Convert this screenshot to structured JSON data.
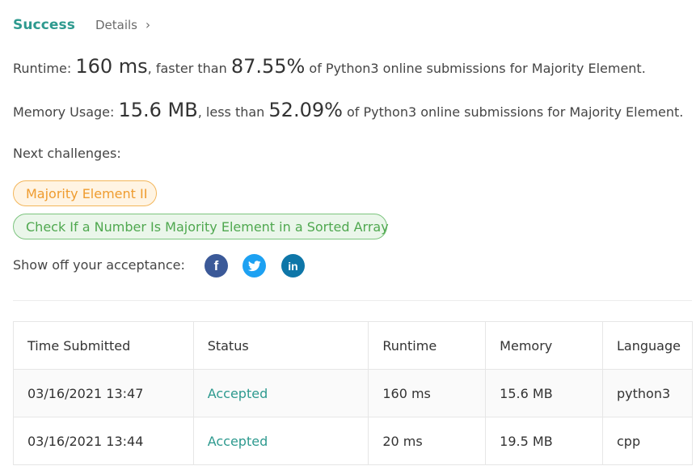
{
  "result": {
    "status": "Success",
    "details_label": "Details",
    "chevron_icon": "chevron-right-icon",
    "status_color": "#2e9a8f"
  },
  "runtime": {
    "prefix": "Runtime: ",
    "value": "160 ms",
    "middle": ", faster than ",
    "percent": "87.55%",
    "suffix": " of Python3 online submissions for Majority Element."
  },
  "memory": {
    "prefix": "Memory Usage: ",
    "value": "15.6 MB",
    "middle": ", less than ",
    "percent": "52.09%",
    "suffix": " of Python3 online submissions for Majority Element."
  },
  "next_challenges": {
    "label": "Next challenges:",
    "items": [
      {
        "title": "Majority Element II",
        "difficulty_color": "#ef9c2f"
      },
      {
        "title": "Check If a Number Is Majority Element in a Sorted Array",
        "difficulty_color": "#4fa84f"
      }
    ]
  },
  "share": {
    "label": "Show off your acceptance:",
    "icons": [
      "facebook-icon",
      "twitter-icon",
      "linkedin-icon"
    ],
    "colors": {
      "facebook": "#3b5998",
      "twitter": "#1da1f2",
      "linkedin": "#0e76a8"
    }
  },
  "submissions": {
    "headers": [
      "Time Submitted",
      "Status",
      "Runtime",
      "Memory",
      "Language"
    ],
    "rows": [
      [
        "03/16/2021 13:47",
        "Accepted",
        "160 ms",
        "15.6 MB",
        "python3"
      ],
      [
        "03/16/2021 13:44",
        "Accepted",
        "20 ms",
        "19.5 MB",
        "cpp"
      ]
    ]
  }
}
